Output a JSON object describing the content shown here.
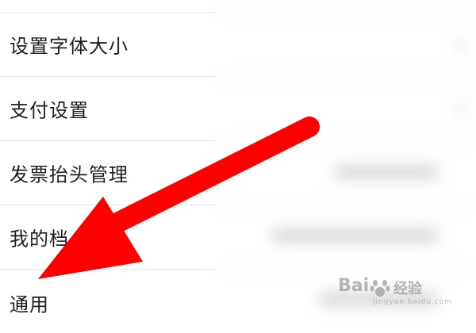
{
  "menu": {
    "items": [
      {
        "label": "设置字体大小"
      },
      {
        "label": "支付设置"
      },
      {
        "label": "发票抬头管理"
      },
      {
        "label": "我的档"
      },
      {
        "label": "通用"
      }
    ]
  },
  "annotation": {
    "arrow_color": "#ff0000"
  },
  "watermark": {
    "brand": "Bai",
    "cn": "经验",
    "url": "jingyan.baidu.com"
  },
  "icons": {
    "arrow": "pointer-arrow-icon",
    "paw": "baidu-paw-icon"
  }
}
